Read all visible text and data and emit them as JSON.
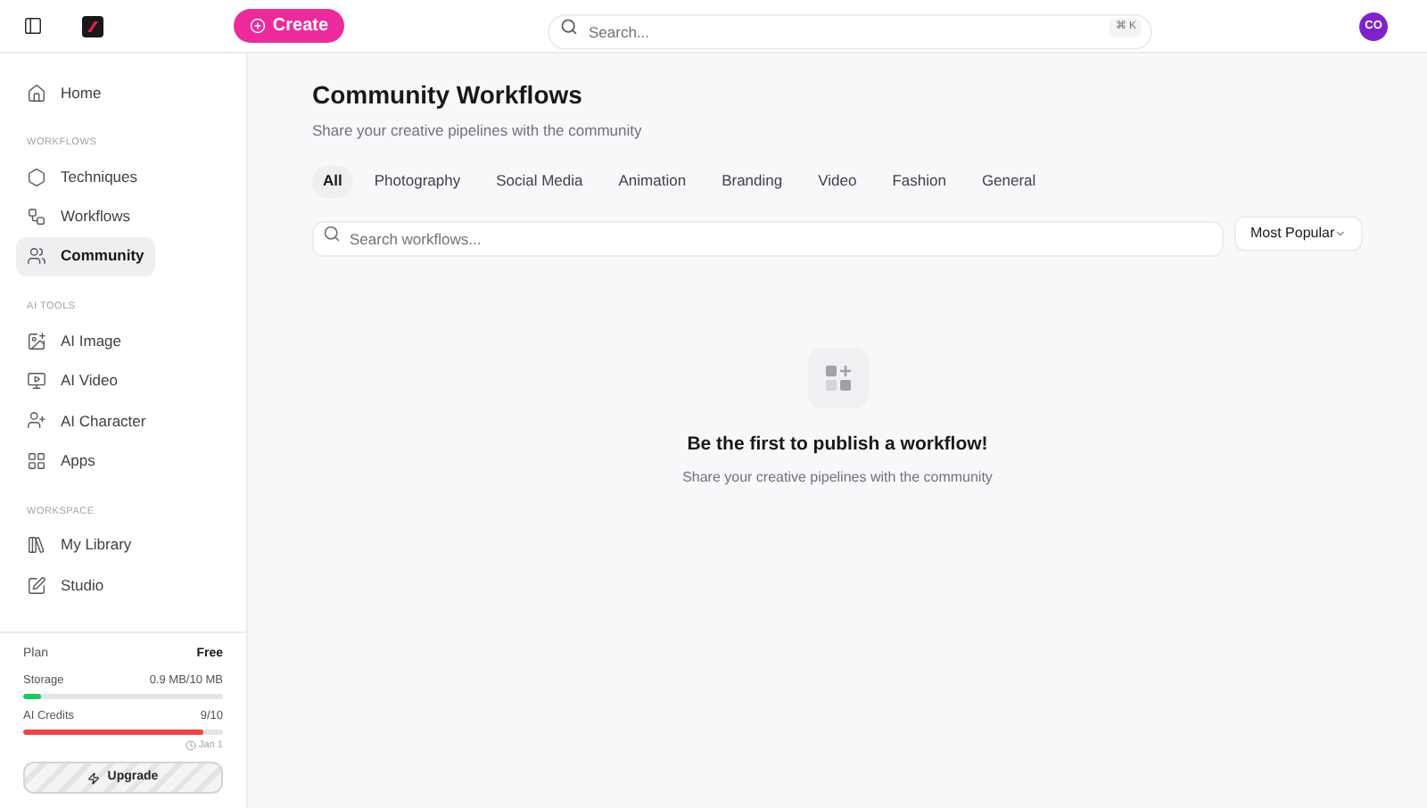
{
  "header": {
    "create_button": "Create",
    "search": {
      "placeholder": "Search...",
      "shortcut": "⌘ K"
    },
    "avatar": "CO"
  },
  "sidebar": {
    "items": [
      {
        "label": "Home",
        "selected": false
      }
    ],
    "sections": [
      {
        "title": "WORKFLOWS",
        "items": [
          {
            "label": "Techniques",
            "selected": false
          },
          {
            "label": "Workflows",
            "selected": false
          },
          {
            "label": "Community",
            "selected": true
          }
        ]
      },
      {
        "title": "AI TOOLS",
        "items": [
          {
            "label": "AI Image",
            "selected": false
          },
          {
            "label": "AI Video",
            "selected": false
          },
          {
            "label": "AI Character",
            "selected": false
          },
          {
            "label": "Apps",
            "selected": false
          }
        ]
      },
      {
        "title": "WORKSPACE",
        "items": [
          {
            "label": "My Library",
            "selected": false
          },
          {
            "label": "Studio",
            "selected": false
          }
        ]
      }
    ],
    "plan": {
      "label": "Plan",
      "value": "Free"
    },
    "meters": [
      {
        "label": "Storage",
        "reading": "0.9 MB/10 MB",
        "level": 0.09,
        "color": "#22c55e"
      },
      {
        "label": "AI Credits",
        "reading": "9/10",
        "level": 0.9,
        "color": "#ef4444"
      }
    ],
    "reset": "Jan 1",
    "upgrade_button": "Upgrade"
  },
  "main": {
    "title": "Community Workflows",
    "subtitle": "Share your creative pipelines with the community",
    "tabs": [
      {
        "label": "All",
        "selected": true
      },
      {
        "label": "Photography",
        "selected": false
      },
      {
        "label": "Social Media",
        "selected": false
      },
      {
        "label": "Animation",
        "selected": false
      },
      {
        "label": "Branding",
        "selected": false
      },
      {
        "label": "Video",
        "selected": false
      },
      {
        "label": "Fashion",
        "selected": false
      },
      {
        "label": "General",
        "selected": false
      }
    ],
    "search": {
      "placeholder": "Search workflows..."
    },
    "sort": "Most Popular",
    "empty": {
      "title": "Be the first to publish a workflow!",
      "text": "Share your creative pipelines with the community"
    }
  }
}
